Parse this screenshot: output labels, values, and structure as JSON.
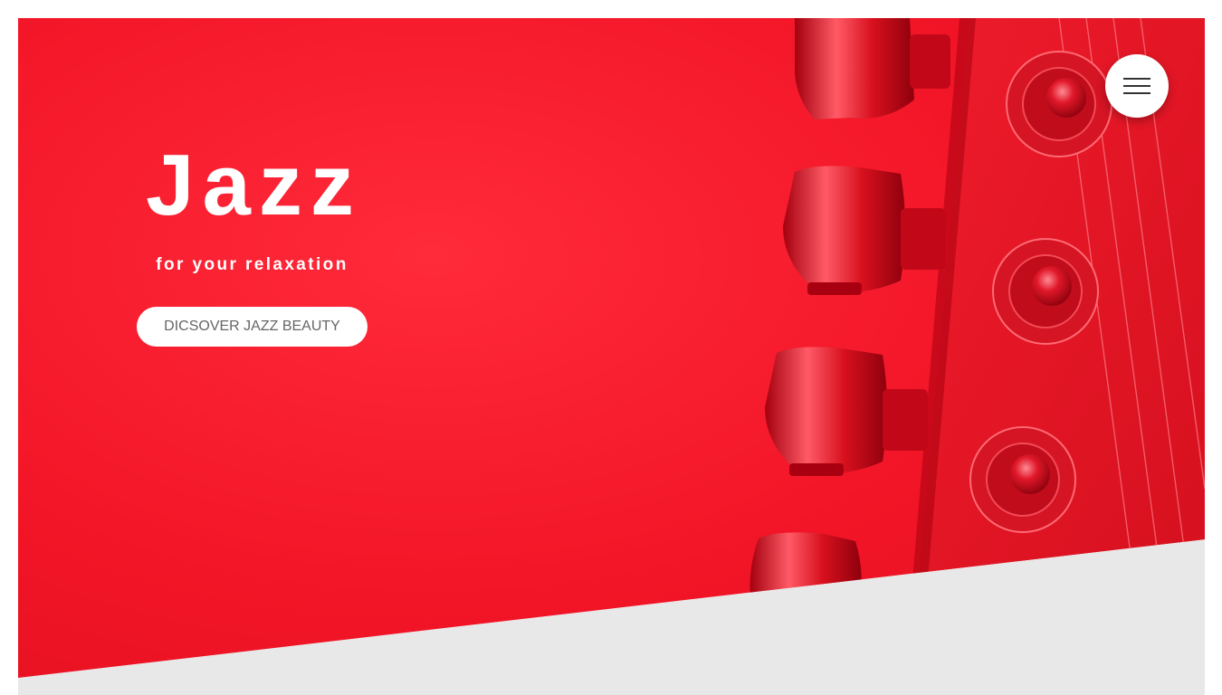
{
  "hero": {
    "title": "Jazz",
    "subtitle": "for your relaxation",
    "cta_label": "DICSOVER JAZZ BEAUTY",
    "background_color": "#f21527",
    "image_subject": "guitar-headstock-tuning-pegs"
  },
  "nav": {
    "menu_icon": "hamburger-menu-icon"
  },
  "colors": {
    "accent": "#ff1f2f",
    "section_below": "#e8e8e8",
    "button_text": "#666666"
  }
}
